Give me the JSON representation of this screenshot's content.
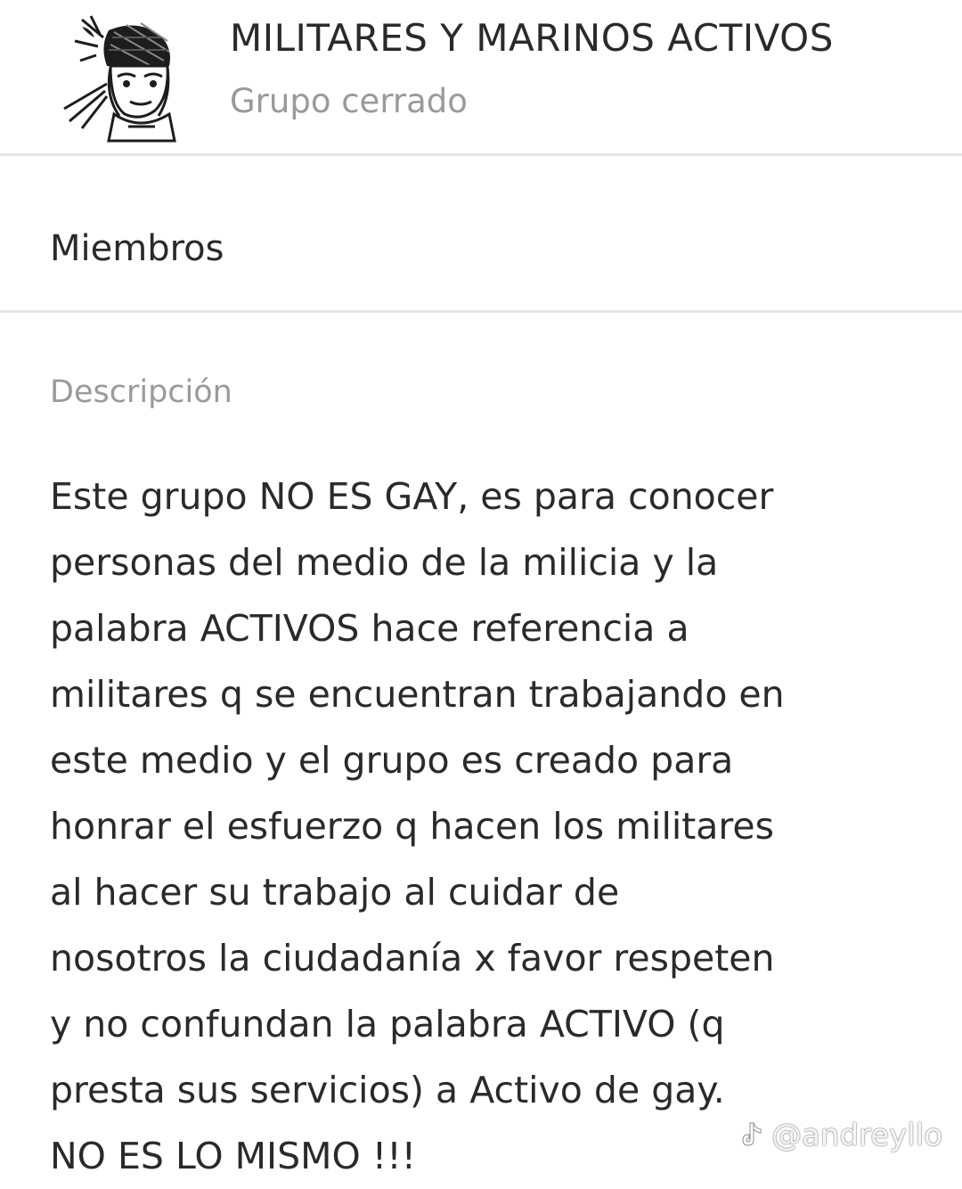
{
  "group": {
    "name": "MILITARES Y MARINOS ACTIVOS",
    "type": "Grupo cerrado",
    "avatar_icon": "soldier-avatar-icon"
  },
  "members": {
    "label": "Miembros"
  },
  "description": {
    "label": "Descripción",
    "lines": [
      "Este grupo NO ES GAY, es para conocer",
      "personas del medio de la milicia y la",
      "palabra ACTIVOS hace referencia a",
      "militares q se encuentran trabajando en",
      "este medio y el grupo es creado para",
      "honrar el esfuerzo q hacen los militares",
      "al hacer su trabajo al cuidar de",
      "nosotros la ciudadanía x favor respeten",
      "y no confundan la palabra ACTIVO (q",
      "presta sus servicios) a Activo de gay.",
      "NO ES LO MISMO !!!"
    ]
  },
  "watermark": {
    "icon": "tiktok-icon",
    "text": "@andreyllo"
  }
}
